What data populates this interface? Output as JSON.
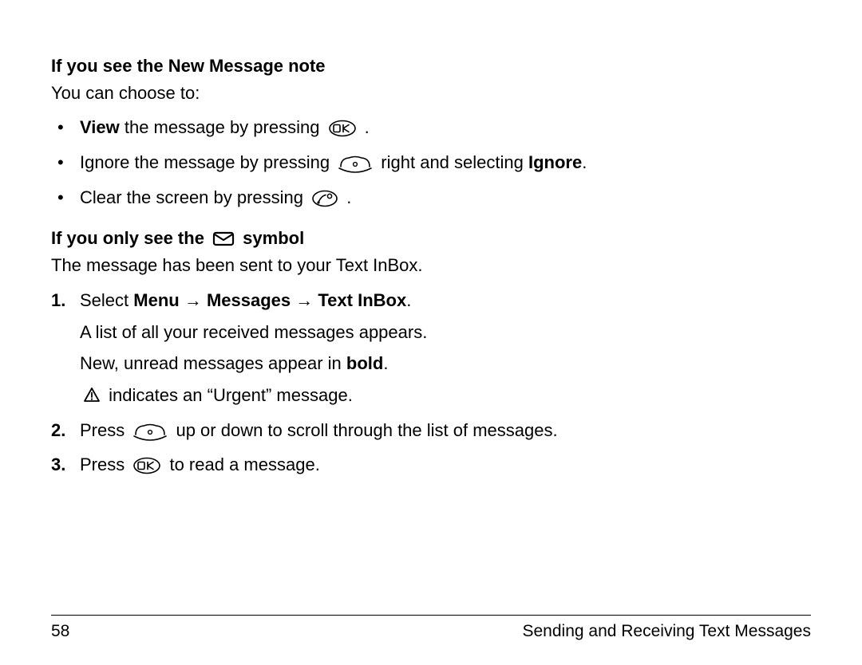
{
  "section1": {
    "heading": "If you see the New Message note",
    "lead": "You can choose to:",
    "bullets": [
      {
        "pre_bold": "View",
        "pre_tail": " the message by pressing ",
        "tail": " ."
      },
      {
        "pre": "Ignore the message by pressing ",
        "mid": " right and selecting ",
        "mid_bold": "Ignore",
        "tail": "."
      },
      {
        "pre": "Clear the screen by pressing ",
        "tail": " ."
      }
    ]
  },
  "section2": {
    "heading_pre": "If you only see the ",
    "heading_post": " symbol",
    "lead": "The message has been sent to your Text InBox.",
    "steps": {
      "s1_pre": "Select ",
      "s1_b1": "Menu",
      "s1_arrow": " → ",
      "s1_b2": "Messages",
      "s1_b3": "Text InBox",
      "s1_tail": ".",
      "s1_sub1": "A list of all your received messages appears.",
      "s1_sub2_pre": "New, unread messages appear in ",
      "s1_sub2_bold": "bold",
      "s1_sub2_tail": ".",
      "s1_sub3_tail": " indicates an “Urgent” message.",
      "s2_pre": "Press ",
      "s2_tail": " up or down to scroll through the list of messages.",
      "s3_pre": "Press ",
      "s3_tail": " to read a message."
    }
  },
  "footer": {
    "page": "58",
    "title": "Sending and Receiving Text Messages"
  }
}
